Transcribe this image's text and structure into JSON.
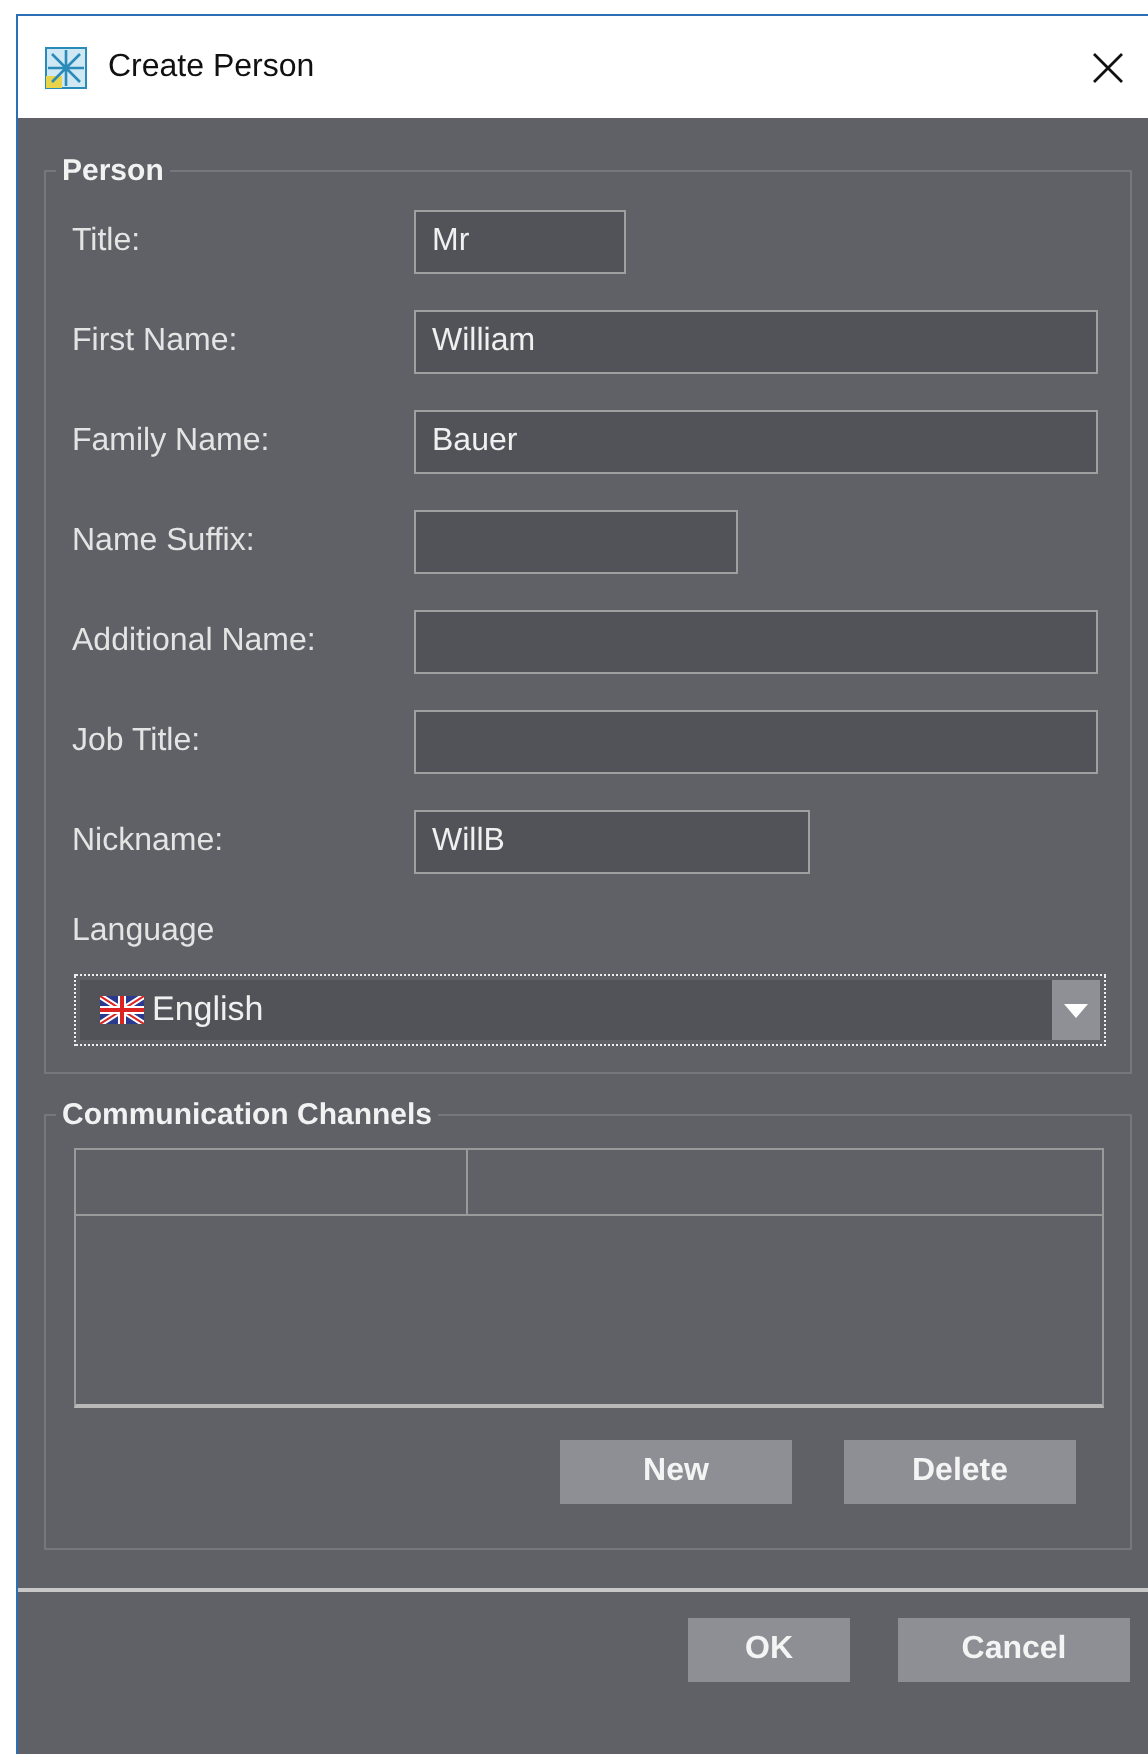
{
  "window": {
    "title": "Create Person"
  },
  "person": {
    "heading": "Person",
    "fields": [
      {
        "label": "Title:",
        "value": "Mr"
      },
      {
        "label": "First Name:",
        "value": "William"
      },
      {
        "label": "Family Name:",
        "value": "Bauer"
      },
      {
        "label": "Name Suffix:"
      },
      {
        "label": "Additional Name:"
      },
      {
        "label": "Job Title:"
      },
      {
        "label": "Nickname:",
        "value": "WillB"
      }
    ],
    "language": {
      "label": "Language",
      "value": "English"
    }
  },
  "channels": {
    "heading": "Communication Channels",
    "buttons": [
      "New",
      "Delete"
    ]
  },
  "buttons": [
    "OK",
    "Cancel"
  ]
}
